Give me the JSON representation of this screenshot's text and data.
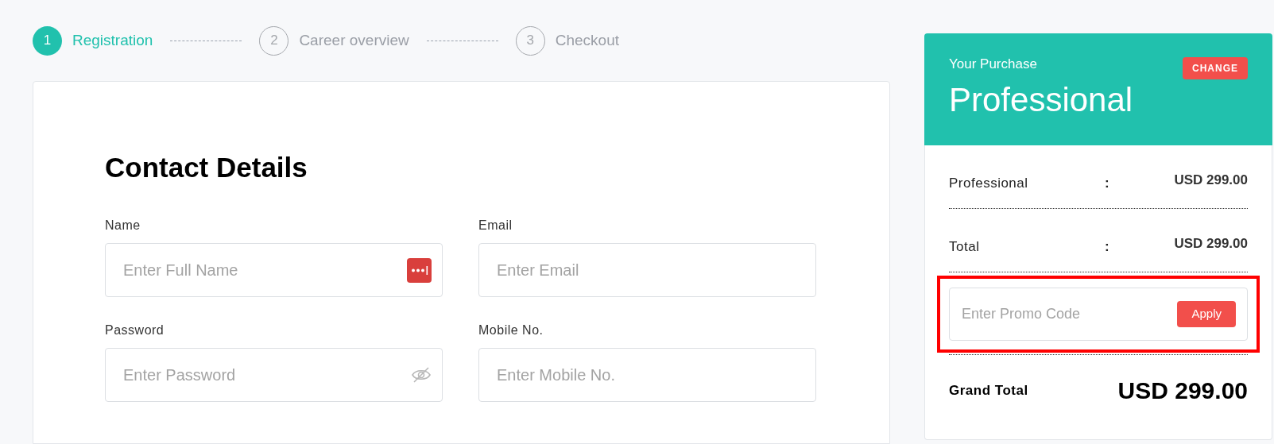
{
  "steps": [
    {
      "number": "1",
      "label": "Registration",
      "selected": true
    },
    {
      "number": "2",
      "label": "Career overview",
      "selected": false
    },
    {
      "number": "3",
      "label": "Checkout",
      "selected": false
    }
  ],
  "form": {
    "title": "Contact Details",
    "fields": [
      {
        "label": "Name",
        "placeholder": "Enter Full Name",
        "kind": "autofill"
      },
      {
        "label": "Email",
        "placeholder": "Enter Email",
        "kind": "plain"
      },
      {
        "label": "Password",
        "placeholder": "Enter Password",
        "kind": "password"
      },
      {
        "label": "Mobile No.",
        "placeholder": "Enter Mobile No.",
        "kind": "plain"
      }
    ]
  },
  "purchase": {
    "caption": "Your Purchase",
    "plan": "Professional",
    "change_button": "CHANGE",
    "rows": [
      {
        "label": "Professional",
        "separator": ":",
        "amount": "USD 299.00"
      },
      {
        "label": "Total",
        "separator": ":",
        "amount": "USD 299.00"
      }
    ],
    "promo": {
      "placeholder": "Enter Promo Code",
      "button": "Apply",
      "highlighted": true
    },
    "grand_total": {
      "label": "Grand Total",
      "amount": "USD 299.00"
    }
  }
}
